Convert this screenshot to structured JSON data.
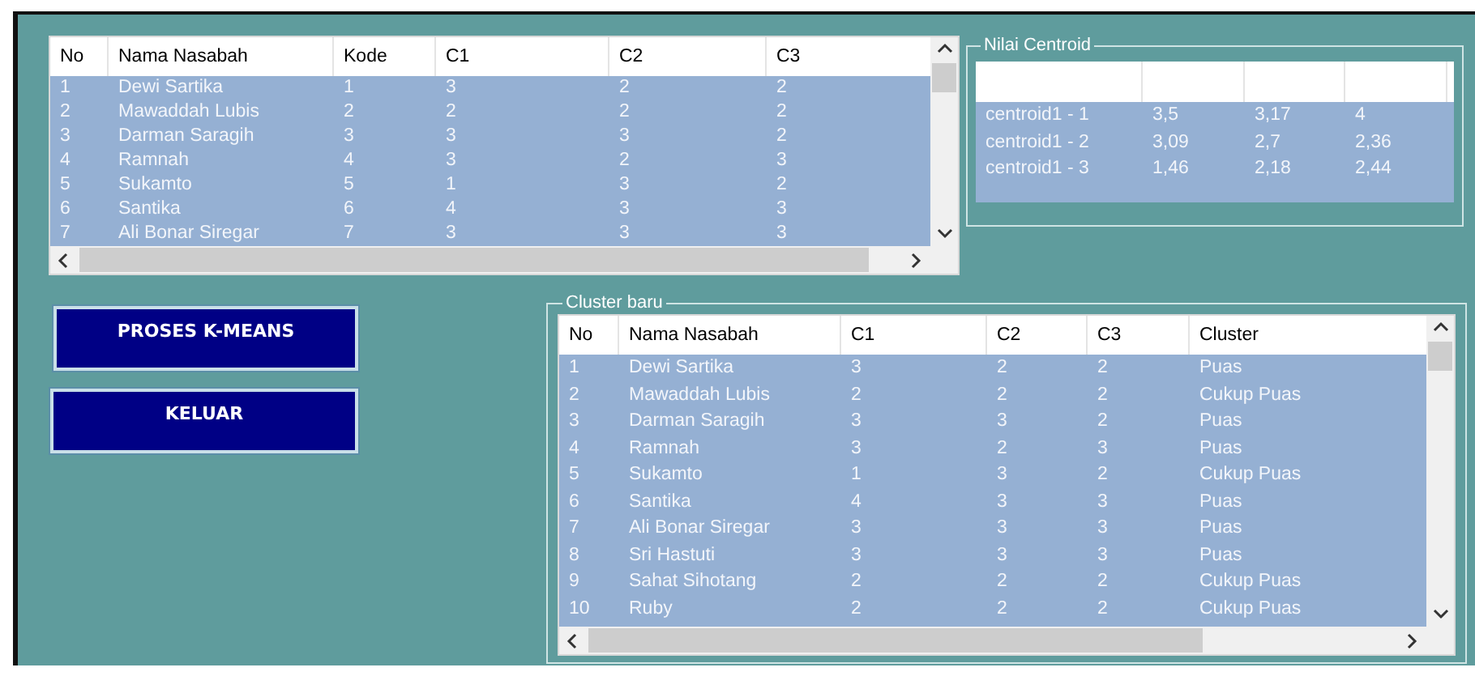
{
  "data_table": {
    "columns": [
      "No",
      "Nama Nasabah",
      "Kode",
      "C1",
      "C2",
      "C3"
    ],
    "rows": [
      [
        "1",
        "Dewi Sartika",
        "1",
        "3",
        "2",
        "2"
      ],
      [
        "2",
        "Mawaddah Lubis",
        "2",
        "2",
        "2",
        "2"
      ],
      [
        "3",
        "Darman Saragih",
        "3",
        "3",
        "3",
        "2"
      ],
      [
        "4",
        "Ramnah",
        "4",
        "3",
        "2",
        "3"
      ],
      [
        "5",
        "Sukamto",
        "5",
        "1",
        "3",
        "2"
      ],
      [
        "6",
        "Santika",
        "6",
        "4",
        "3",
        "3"
      ],
      [
        "7",
        "Ali Bonar Siregar",
        "7",
        "3",
        "3",
        "3"
      ]
    ]
  },
  "centroid_group": {
    "title": "Nilai Centroid",
    "rows": [
      [
        "centroid1 - 1",
        "3,5",
        "3,17",
        "4"
      ],
      [
        "centroid1 - 2",
        "3,09",
        "2,7",
        "2,36"
      ],
      [
        "centroid1 - 3",
        "1,46",
        "2,18",
        "2,44"
      ]
    ]
  },
  "buttons": [
    {
      "label": "PROSES K-MEANS"
    },
    {
      "label": "KELUAR"
    }
  ],
  "cluster_group": {
    "title": "Cluster baru",
    "columns": [
      "No",
      "Nama Nasabah",
      "C1",
      "C2",
      "C3",
      "Cluster"
    ],
    "rows": [
      [
        "1",
        "Dewi Sartika",
        "3",
        "2",
        "2",
        "Puas"
      ],
      [
        "2",
        "Mawaddah Lubis",
        "2",
        "2",
        "2",
        "Cukup Puas"
      ],
      [
        "3",
        "Darman Saragih",
        "3",
        "3",
        "2",
        "Puas"
      ],
      [
        "4",
        "Ramnah",
        "3",
        "2",
        "3",
        "Puas"
      ],
      [
        "5",
        "Sukamto",
        "1",
        "3",
        "2",
        "Cukup Puas"
      ],
      [
        "6",
        "Santika",
        "4",
        "3",
        "3",
        "Puas"
      ],
      [
        "7",
        "Ali Bonar Siregar",
        "3",
        "3",
        "3",
        "Puas"
      ],
      [
        "8",
        "Sri Hastuti",
        "3",
        "3",
        "3",
        "Puas"
      ],
      [
        "9",
        "Sahat Sihotang",
        "2",
        "2",
        "2",
        "Cukup Puas"
      ],
      [
        "10",
        "Ruby",
        "2",
        "2",
        "2",
        "Cukup Puas"
      ]
    ]
  }
}
